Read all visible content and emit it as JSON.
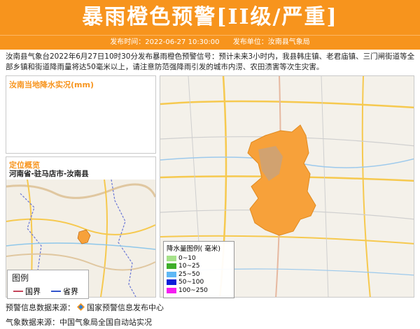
{
  "header": {
    "title": "暴雨橙色预警[II级/严重]"
  },
  "subbar": {
    "time": "发布时间：2022-06-27 10:30:00",
    "unit": "发布单位：汝南县气象局"
  },
  "description": "汝南县气象台2022年6月27日10时30分发布暴雨橙色预警信号：预计未来3小时内，我县韩庄镇、老君庙镇、三门闸街道等全部乡镇和街道降雨量将达50毫米以上，请注意防范强降雨引发的城市内涝、农田渍害等次生灾害。",
  "rain_panel": {
    "title": "汝南当地降水实况(mm)"
  },
  "location_panel": {
    "title": "定位概览",
    "region": "河南省-驻马店市-汝南县"
  },
  "small_legend": {
    "title": "图例",
    "national": "国界",
    "provincial": "省界"
  },
  "rain_legend": {
    "title": "降水量图例( 毫米)",
    "items": [
      {
        "label": "0~10",
        "color": "#a6e28a"
      },
      {
        "label": "10~25",
        "color": "#3fae2a"
      },
      {
        "label": "25~50",
        "color": "#5fb8f5"
      },
      {
        "label": "50~100",
        "color": "#0a1ed8"
      },
      {
        "label": "100~250",
        "color": "#f41df0"
      }
    ]
  },
  "footer": {
    "source_label": "预警信息数据来源：",
    "source_name": "国家预警信息发布中心",
    "weather_label": "气象数据来源：",
    "weather_name": "中国气象局全国自动站实况"
  },
  "colors": {
    "accent": "#f7941d",
    "region_fill": "#f7a13a"
  },
  "icons": {
    "source": "warning-center-logo-icon"
  }
}
